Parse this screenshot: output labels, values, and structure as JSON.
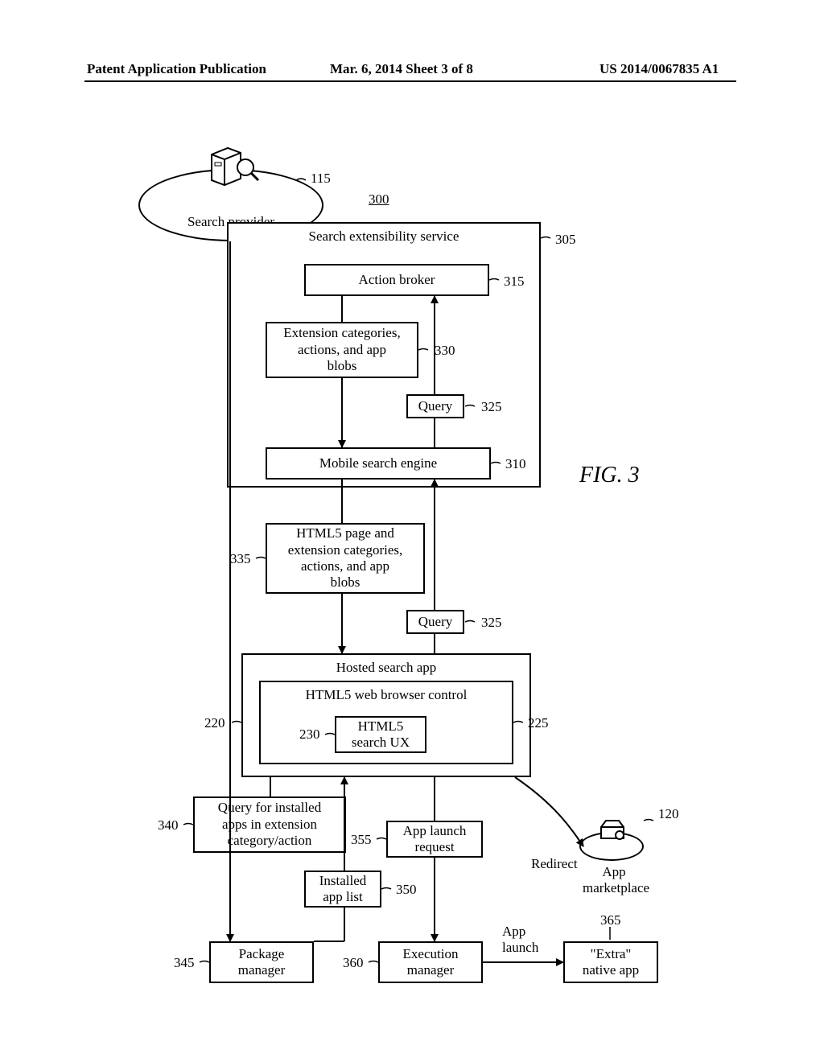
{
  "header": {
    "left": "Patent Application Publication",
    "center": "Mar. 6, 2014   Sheet 3 of 8",
    "right": "US 2014/0067835 A1"
  },
  "figure_label": "FIG. 3",
  "ellipses": {
    "search_provider": "Search provider",
    "app_marketplace": "App\nmarketplace"
  },
  "boxes": {
    "ext_service": "Search extensibility service",
    "action_broker": "Action broker",
    "ext_cats": "Extension categories,\nactions, and app\nblobs",
    "query_upper": "Query",
    "mobile_search": "Mobile search engine",
    "html5_page": "HTML5 page and\nextension categories,\nactions, and app\nblobs",
    "query_lower": "Query",
    "hosted": "Hosted search app",
    "browser_ctrl": "HTML5 web browser control",
    "search_ux": "HTML5\nsearch UX",
    "query_installed": "Query for installed\napps in extension\ncategory/action",
    "app_launch_req": "App launch\nrequest",
    "installed_list": "Installed\napp list",
    "package_mgr": "Package\nmanager",
    "exec_mgr": "Execution\nmanager",
    "extra_native": "\"Extra\"\nnative app"
  },
  "edge_labels": {
    "redirect": "Redirect",
    "app_launch": "App\nlaunch"
  },
  "nums": {
    "n115": "115",
    "n300": "300",
    "n305": "305",
    "n315": "315",
    "n330": "330",
    "n325a": "325",
    "n310": "310",
    "n335": "335",
    "n325b": "325",
    "n220": "220",
    "n225": "225",
    "n230": "230",
    "n340": "340",
    "n355": "355",
    "n120": "120",
    "n350": "350",
    "n345": "345",
    "n360": "360",
    "n365": "365"
  }
}
